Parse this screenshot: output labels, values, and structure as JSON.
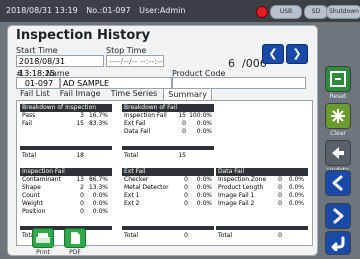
{
  "status": {
    "datetime": "2018/08/31 13:19",
    "no": "No.:01-097",
    "user": "User:Admin",
    "usb_label": "USB",
    "sd_label": "SD",
    "shutdown_label": "Shutdown"
  },
  "screen": {
    "title": "Inspection History",
    "start_time_label": "Start Time",
    "stop_time_label": "Stop Time",
    "start_time_value": "2018/08/31 13:18:25",
    "stop_time_value": "----/--/-- --:--:--",
    "record_index": "6",
    "record_total": "/006",
    "hash_label": "#",
    "name_label": "Name",
    "product_code_label": "Product Code",
    "record_no": "01-097",
    "record_name": "AD SAMPLE",
    "record_product_code": ""
  },
  "tabs": [
    {
      "label": "Fail List"
    },
    {
      "label": "Fail Image"
    },
    {
      "label": "Time Series"
    },
    {
      "label": "Summary"
    }
  ],
  "summary": {
    "breakdown_inspection": {
      "title": "Breakdown of Inspection",
      "rows": [
        {
          "name": "Pass",
          "count": "3",
          "pct": "16.7%"
        },
        {
          "name": "Fail",
          "count": "15",
          "pct": "83.3%"
        }
      ],
      "total_label": "Total",
      "total": "18"
    },
    "breakdown_fail": {
      "title": "Breakdown of Fail",
      "rows": [
        {
          "name": "Inspection Fail",
          "count": "15",
          "pct": "100.0%"
        },
        {
          "name": "Ext Fail",
          "count": "0",
          "pct": "0.0%"
        },
        {
          "name": "Data Fail",
          "count": "0",
          "pct": "0.0%"
        }
      ],
      "total_label": "Total",
      "total": "15"
    },
    "inspection_fail": {
      "title": "Inspection Fail",
      "rows": [
        {
          "name": "Contaminant",
          "count": "13",
          "pct": "86.7%"
        },
        {
          "name": "Shape",
          "count": "2",
          "pct": "13.3%"
        },
        {
          "name": "Count",
          "count": "0",
          "pct": "0.0%"
        },
        {
          "name": "Weight",
          "count": "0",
          "pct": "0.0%"
        },
        {
          "name": "Position",
          "count": "0",
          "pct": "0.0%"
        }
      ],
      "total_label": "Total",
      "total": "15"
    },
    "ext_fail": {
      "title": "Ext Fail",
      "rows": [
        {
          "name": "Checker",
          "count": "0",
          "pct": "0.0%"
        },
        {
          "name": "Metal Detector",
          "count": "0",
          "pct": "0.0%"
        },
        {
          "name": "Ext 1",
          "count": "0",
          "pct": "0.0%"
        },
        {
          "name": "Ext 2",
          "count": "0",
          "pct": "0.0%"
        }
      ],
      "total_label": "Total",
      "total": "0"
    },
    "data_fail": {
      "title": "Data Fail",
      "rows": [
        {
          "name": "Inspection Zone",
          "count": "0",
          "pct": "0.0%"
        },
        {
          "name": "Product Length",
          "count": "0",
          "pct": "0.0%"
        },
        {
          "name": "Image Fail 1",
          "count": "0",
          "pct": "0.0%"
        },
        {
          "name": "Image Fail 2",
          "count": "0",
          "pct": "0.0%"
        }
      ],
      "total_label": "Total",
      "total": "0"
    }
  },
  "bottom_buttons": {
    "print": "Print",
    "pdf": "PDF"
  },
  "side_buttons": {
    "reset": "Reset",
    "clear": "Clear",
    "update": "Update"
  }
}
